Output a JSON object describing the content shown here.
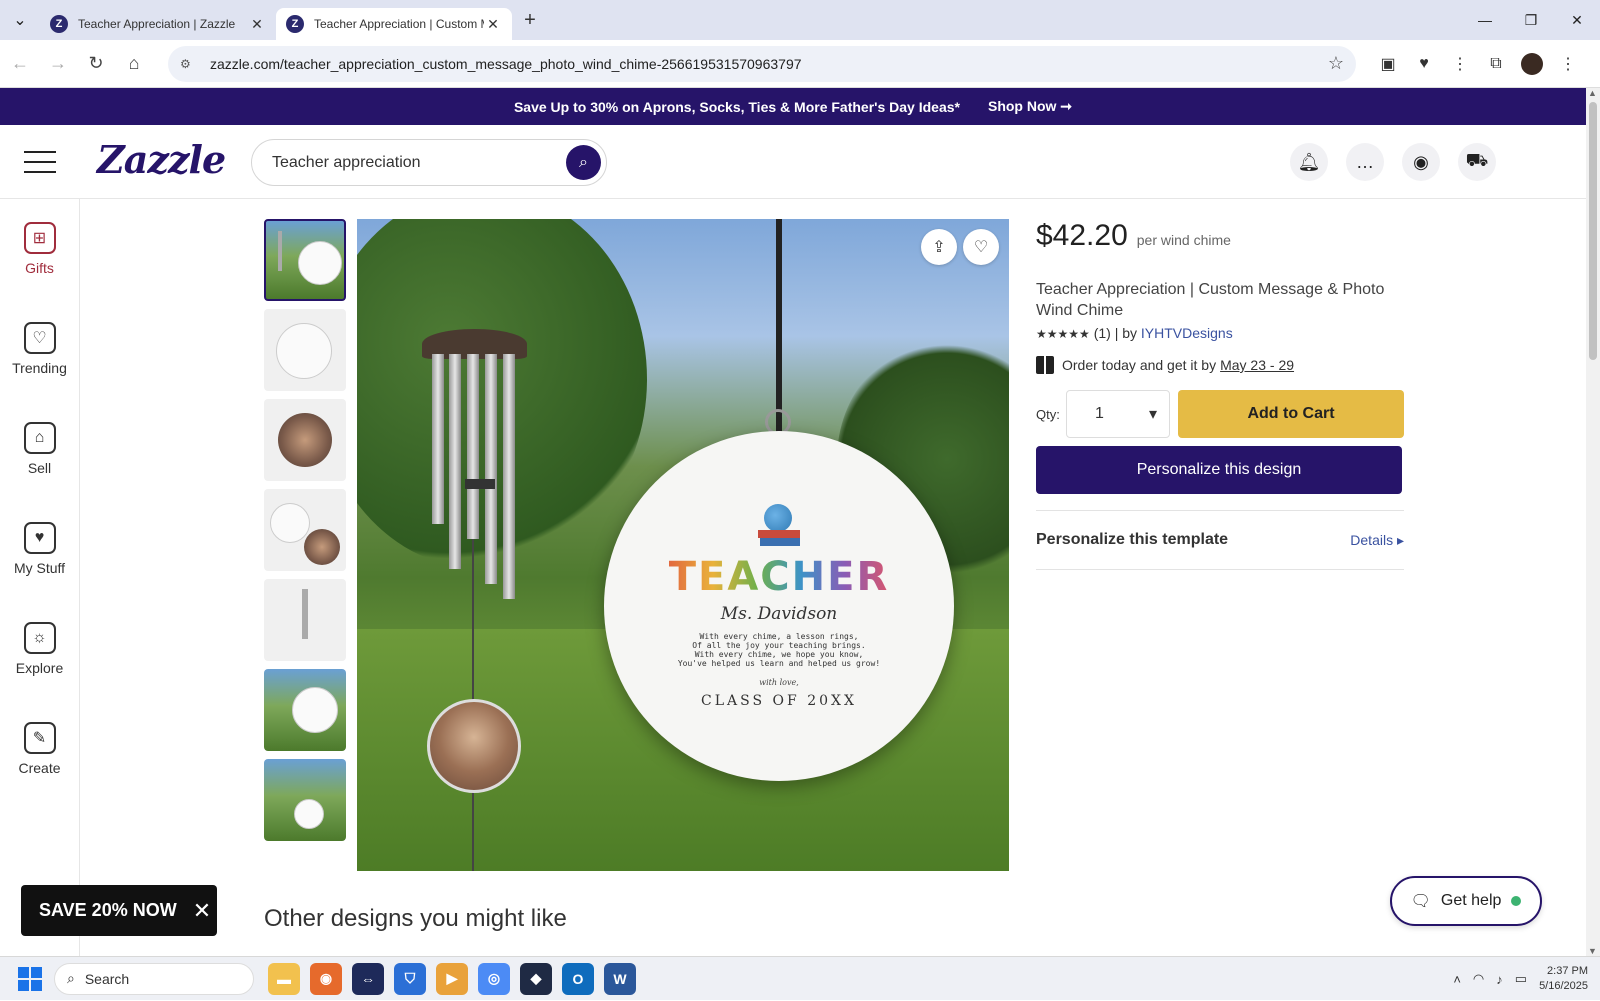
{
  "browser": {
    "tabs": [
      {
        "title": "Teacher Appreciation | Zazzle",
        "active": false
      },
      {
        "title": "Teacher Appreciation | Custom Me",
        "active": true
      }
    ],
    "url": "zazzle.com/teacher_appreciation_custom_message_photo_wind_chime-256619531570963797"
  },
  "promo": {
    "text": "Save Up to 30% on Aprons, Socks, Ties & More Father's Day Ideas*",
    "cta": "Shop Now ➞"
  },
  "header": {
    "logo": "Zazzle",
    "search_value": "Teacher appreciation"
  },
  "rail": {
    "items": [
      {
        "label": "Gifts",
        "icon": "gift-icon"
      },
      {
        "label": "Trending",
        "icon": "trending-icon"
      },
      {
        "label": "Sell",
        "icon": "store-icon"
      },
      {
        "label": "My Stuff",
        "icon": "folder-icon"
      },
      {
        "label": "Explore",
        "icon": "lightbulb-icon"
      },
      {
        "label": "Create",
        "icon": "pencil-icon"
      }
    ]
  },
  "product": {
    "price": "$42.20",
    "price_unit": "per wind chime",
    "title": "Teacher Appreciation | Custom Message & Photo Wind Chime",
    "stars": "★★★★★",
    "rating_count": "(1)",
    "by_text": "| by",
    "designer": "IYHTVDesigns",
    "delivery_text": "Order today and get it by",
    "delivery_dates": "May 23 - 29",
    "qty_label": "Qty:",
    "qty_value": "1",
    "add_to_cart": "Add to Cart",
    "personalize_design": "Personalize this design",
    "personalize_template": "Personalize this template",
    "details": "Details ▸"
  },
  "ornament": {
    "title": "TEACHER",
    "name": "Ms. Davidson",
    "poem": [
      "With every chime, a lesson rings,",
      "Of all the joy your teaching brings.",
      "With every chime, we hope you know,",
      "You've helped us learn and helped us grow!"
    ],
    "signoff": "with love,",
    "class": "CLASS OF 20XX"
  },
  "sections": {
    "others": "Other designs you might like"
  },
  "popups": {
    "save": "SAVE 20% NOW",
    "help": "Get help"
  },
  "taskbar": {
    "search": "Search",
    "time": "2:37 PM",
    "date": "5/16/2025"
  }
}
